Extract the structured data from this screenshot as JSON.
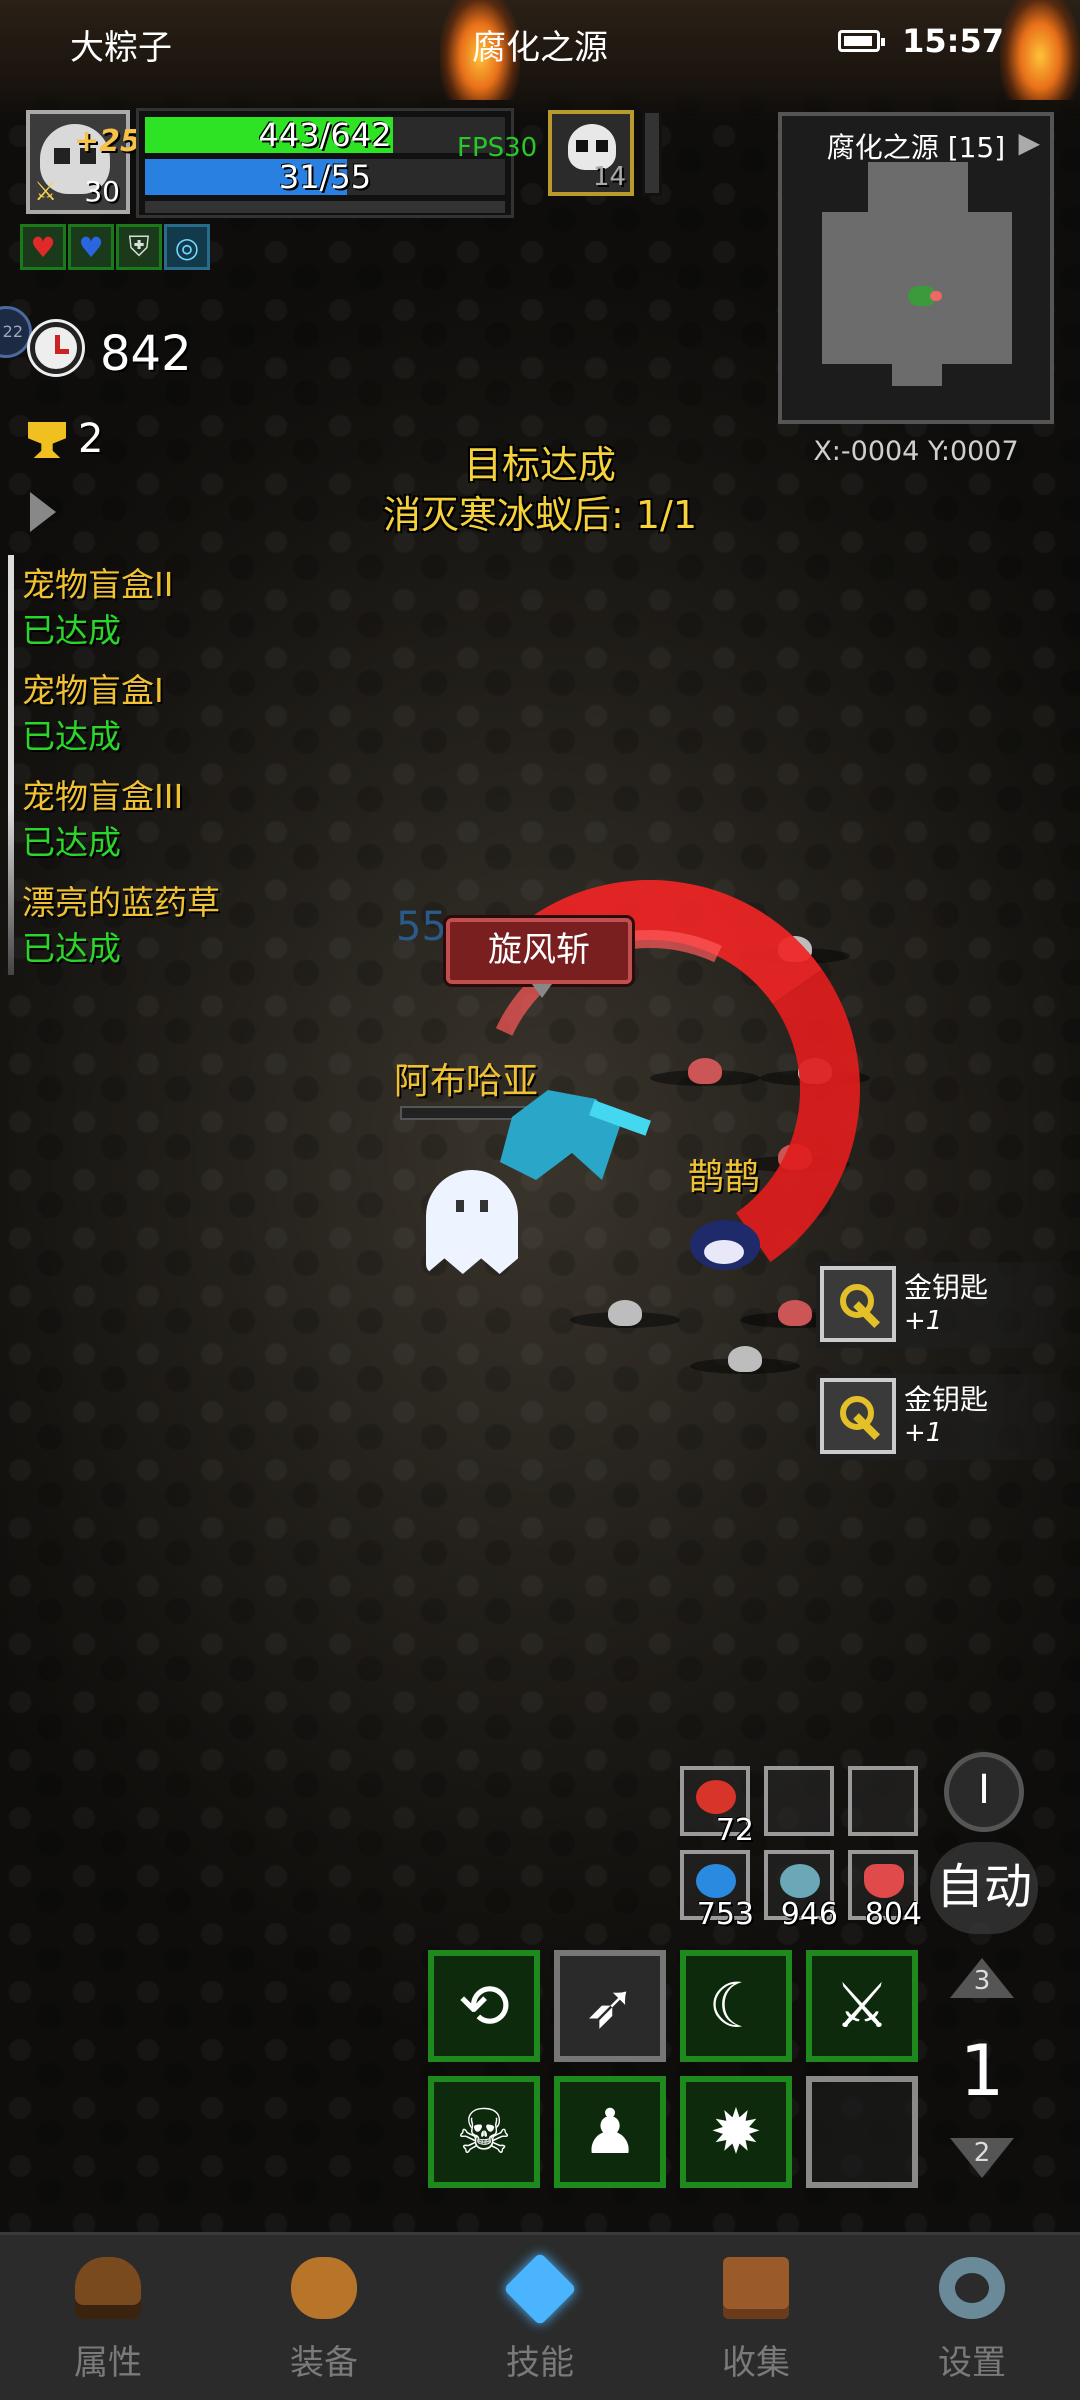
{
  "status_bar": {
    "player_name": "大粽子",
    "zone_title": "腐化之源",
    "time": "15:57"
  },
  "player": {
    "upgrade_bonus": "+25",
    "level": "30",
    "hp_text": "443/642",
    "hp_fraction": 0.69,
    "mp_text": "31/55",
    "mp_fraction": 0.56,
    "fps": "FPS30",
    "pet_level": "14",
    "buffs": [
      "heart-buff-icon",
      "mana-buff-icon",
      "shield-buff-icon",
      "water-buff-icon"
    ]
  },
  "minimap": {
    "title": "腐化之源 [15]",
    "coords": "X:-0004  Y:0007"
  },
  "counters": {
    "side_badge": "22",
    "turns": "842",
    "trophies": "2"
  },
  "objective": {
    "line1": "目标达成",
    "line2": "消灭寒冰蚁后: 1/1"
  },
  "quests": [
    {
      "name": "宠物盲盒II",
      "status": "已达成"
    },
    {
      "name": "宠物盲盒I",
      "status": "已达成"
    },
    {
      "name": "宠物盲盒III",
      "status": "已达成"
    },
    {
      "name": "漂亮的蓝药草",
      "status": "已达成"
    }
  ],
  "scene": {
    "skill_popup": "旋风斩",
    "damage_number": "55",
    "hero_name": "阿布哈亚",
    "pet_name": "鹊鹊"
  },
  "loot": [
    {
      "name": "金钥匙",
      "count": "+1",
      "icon": "gold-key-icon"
    },
    {
      "name": "金钥匙",
      "count": "+1",
      "icon": "gold-key-icon"
    }
  ],
  "quick_items": {
    "row1": [
      {
        "count": "72",
        "icon": "meat-icon"
      },
      {
        "count": "",
        "icon": ""
      },
      {
        "count": "",
        "icon": ""
      }
    ],
    "row2": [
      {
        "count": "753",
        "icon": "blue-fish-icon"
      },
      {
        "count": "946",
        "icon": "fish-icon"
      },
      {
        "count": "804",
        "icon": "potion-icon"
      }
    ]
  },
  "controls": {
    "round_button": "I",
    "auto_label": "自动",
    "page_up": "3",
    "page_current": "1",
    "page_down": "2"
  },
  "nav": [
    {
      "label": "属性",
      "icon": "helmet-icon"
    },
    {
      "label": "装备",
      "icon": "bag-icon"
    },
    {
      "label": "技能",
      "icon": "gem-icon"
    },
    {
      "label": "收集",
      "icon": "book-icon"
    },
    {
      "label": "设置",
      "icon": "gear-icon"
    }
  ],
  "colors": {
    "hp": "#2ee323",
    "mp": "#2a80e0",
    "quest_name": "#f0c233",
    "quest_done": "#2ad62a",
    "skill_border": "#1e8a1e"
  }
}
